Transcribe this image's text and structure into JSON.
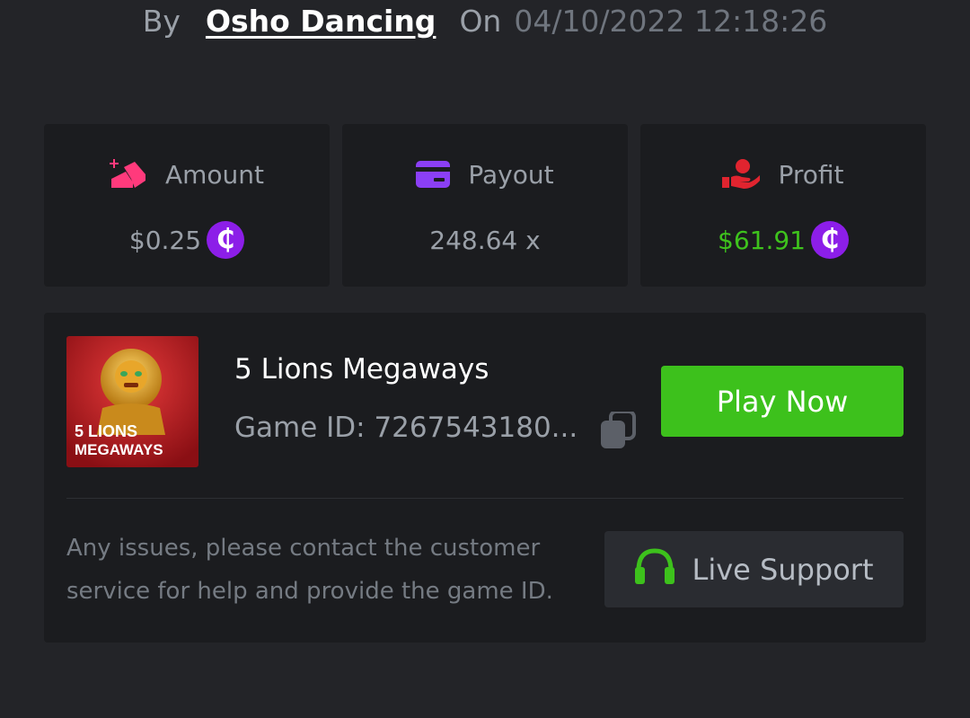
{
  "byline": {
    "by_label": "By",
    "username": "Osho Dancing",
    "on_label": "On",
    "datetime": "04/10/2022 12:18:26"
  },
  "stats": {
    "amount": {
      "label": "Amount",
      "value": "$0.25",
      "icon": "coins-stack-icon"
    },
    "payout": {
      "label": "Payout",
      "value": "248.64 x",
      "icon": "credit-card-icon"
    },
    "profit": {
      "label": "Profit",
      "value": "$61.91",
      "icon": "hand-money-icon"
    }
  },
  "coin_symbol": "₵",
  "game": {
    "title": "5 Lions Megaways",
    "id_label": "Game ID: 7267543180...",
    "thumbnail_text_line1": "5 LIONS",
    "thumbnail_text_line2": "MEGAWAYS",
    "play_label": "Play Now"
  },
  "support": {
    "help_text": "Any issues, please contact the customer service for help and provide the game ID.",
    "button_label": "Live Support"
  },
  "colors": {
    "background": "#232428",
    "card": "#1b1c1f",
    "accent_green": "#3dc11c",
    "coin_purple": "#8c1ee8",
    "amount_icon_pink": "#ff3a7c",
    "payout_icon_purple": "#8b3ff5",
    "profit_icon_red": "#e0242f"
  }
}
